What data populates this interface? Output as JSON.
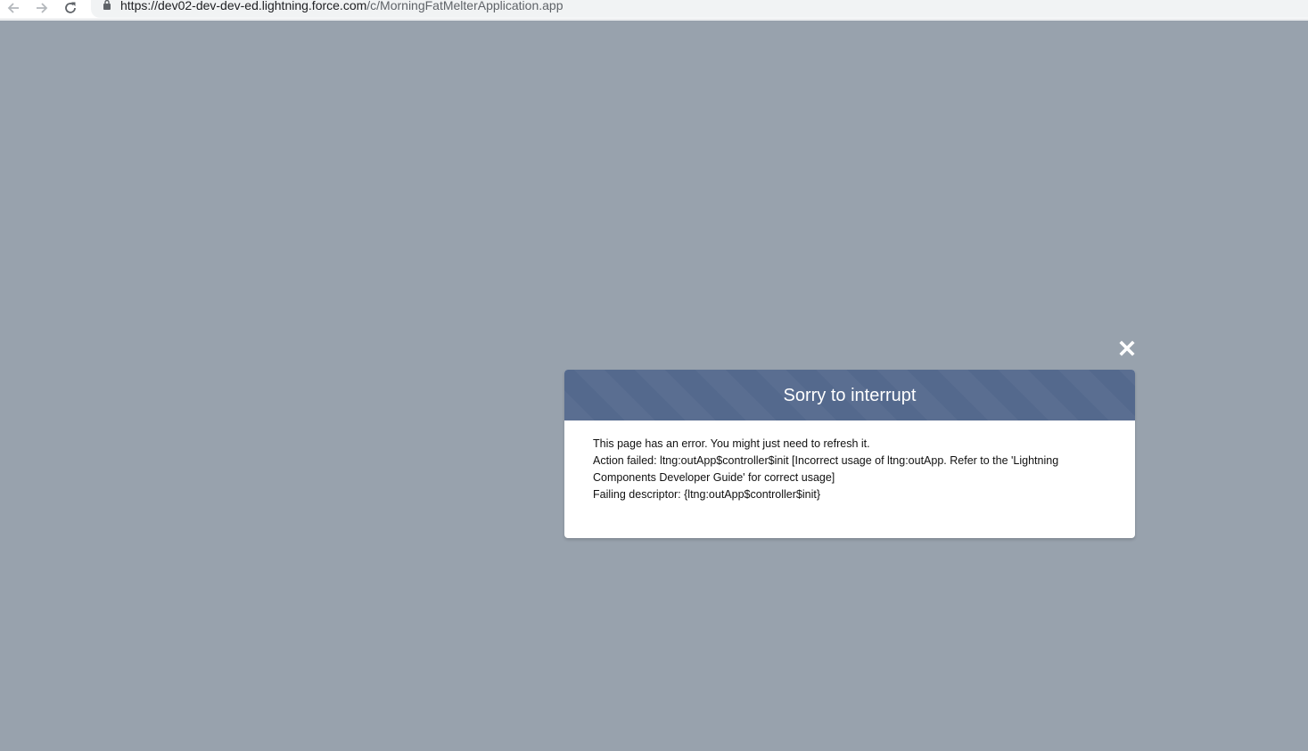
{
  "browser": {
    "url_host": "https://dev02-dev-dev-ed.lightning.force.com",
    "url_path": "/c/MorningFatMelterApplication.app"
  },
  "error_modal": {
    "title": "Sorry to interrupt",
    "lines": [
      "This page has an error. You might just need to refresh it.",
      "Action failed: ltng:outApp$controller$init [Incorrect usage of ltng:outApp. Refer to the 'Lightning Components Developer Guide' for correct usage]",
      "Failing descriptor: {ltng:outApp$controller$init}"
    ]
  },
  "colors": {
    "backdrop": "#98a2ad",
    "modal_header": "#54698d",
    "modal_body": "#ffffff"
  },
  "icons": {
    "back": "back-arrow-icon",
    "forward": "forward-arrow-icon",
    "reload": "reload-icon",
    "lock": "lock-icon",
    "close": "close-icon"
  }
}
